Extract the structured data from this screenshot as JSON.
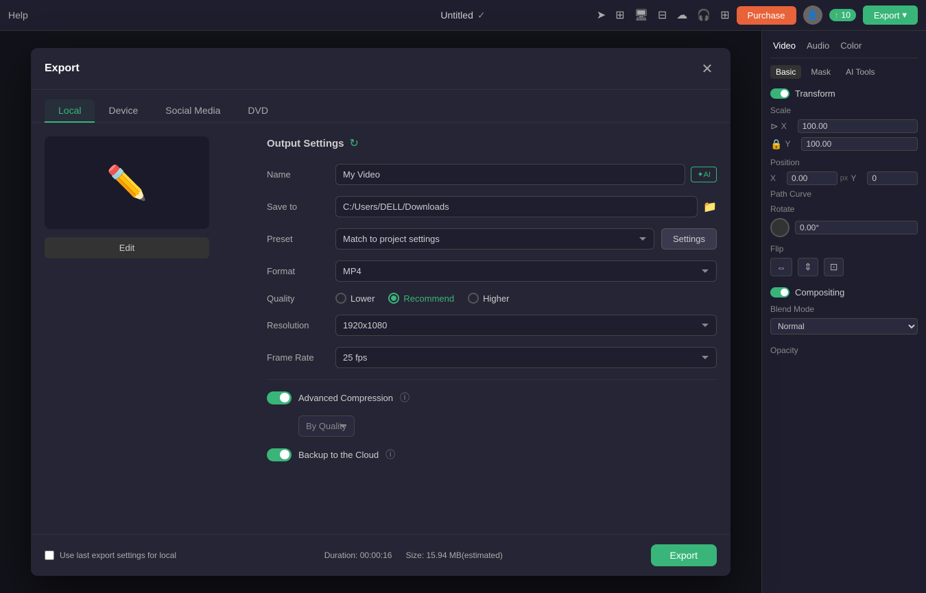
{
  "topbar": {
    "help_label": "Help",
    "title": "Untitled",
    "purchase_label": "Purchase",
    "points": "10",
    "export_label": "Export",
    "chevron": "▾"
  },
  "right_panel": {
    "tabs": [
      "Video",
      "Audio",
      "Color"
    ],
    "subtabs": [
      "Basic",
      "Mask",
      "AI Tools"
    ],
    "transform_label": "Transform",
    "scale_label": "Scale",
    "x_label": "X",
    "y_label": "Y",
    "x_value": "100.00",
    "y_value": "100.00",
    "position_label": "Position",
    "pos_x_label": "X",
    "pos_x_value": "0.00",
    "pos_x_unit": "px",
    "pos_y_label": "Y",
    "pos_y_value": "0",
    "path_curve_label": "Path Curve",
    "rotate_label": "Rotate",
    "rotate_value": "0.00°",
    "flip_label": "Flip",
    "compositing_label": "Compositing",
    "blend_mode_label": "Blend Mode",
    "blend_mode_value": "Normal",
    "opacity_label": "Opacity"
  },
  "modal": {
    "title": "Export",
    "tabs": [
      "Local",
      "Device",
      "Social Media",
      "DVD"
    ],
    "active_tab": "Local",
    "output_settings_title": "Output Settings",
    "name_label": "Name",
    "name_value": "My Video",
    "ai_label": "✦AI",
    "save_to_label": "Save to",
    "save_to_value": "C:/Users/DELL/Downloads",
    "preset_label": "Preset",
    "preset_value": "Match to project settings",
    "settings_btn_label": "Settings",
    "format_label": "Format",
    "format_value": "MP4",
    "quality_label": "Quality",
    "quality_options": [
      {
        "label": "Lower",
        "selected": false
      },
      {
        "label": "Recommend",
        "selected": true
      },
      {
        "label": "Higher",
        "selected": false
      }
    ],
    "resolution_label": "Resolution",
    "resolution_value": "1920x1080",
    "frame_rate_label": "Frame Rate",
    "frame_rate_value": "25 fps",
    "advanced_compression_label": "Advanced Compression",
    "advanced_compression_on": true,
    "by_quality_label": "By Quality",
    "backup_cloud_label": "Backup to the Cloud",
    "backup_cloud_on": true,
    "edit_btn_label": "Edit"
  },
  "footer": {
    "use_last_label": "Use last export settings for local",
    "duration_label": "Duration:",
    "duration_value": "00:00:16",
    "size_label": "Size:",
    "size_value": "15.94 MB(estimated)",
    "export_btn_label": "Export"
  }
}
